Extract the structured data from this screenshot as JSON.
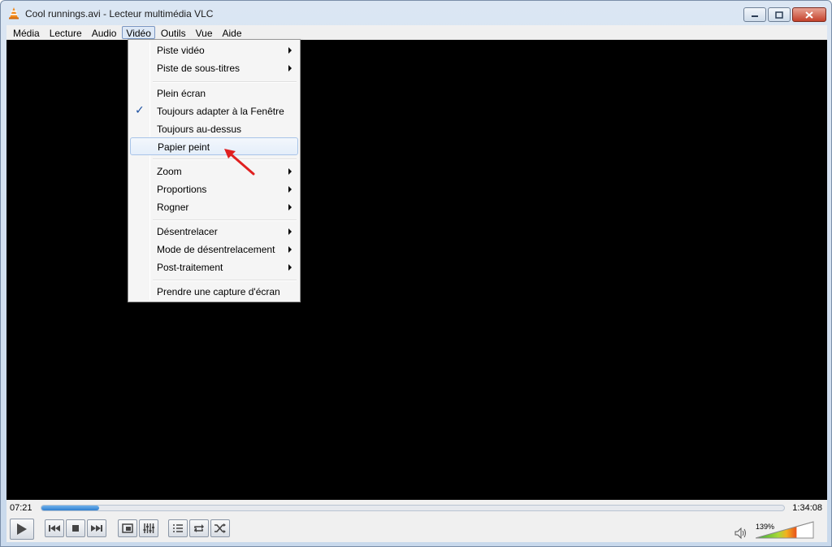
{
  "window": {
    "title": "Cool runnings.avi - Lecteur multimédia VLC"
  },
  "menubar": {
    "items": [
      "Média",
      "Lecture",
      "Audio",
      "Vidéo",
      "Outils",
      "Vue",
      "Aide"
    ],
    "active": "Vidéo"
  },
  "video_menu": {
    "items": [
      {
        "label": "Piste vidéo",
        "submenu": true
      },
      {
        "label": "Piste de sous-titres",
        "submenu": true
      },
      {
        "label": "Plein écran"
      },
      {
        "label": "Toujours adapter à la Fenêtre",
        "checked": true
      },
      {
        "label": "Toujours au-dessus"
      },
      {
        "label": "Papier peint",
        "highlighted": true
      },
      {
        "label": "Zoom",
        "submenu": true
      },
      {
        "label": "Proportions",
        "submenu": true
      },
      {
        "label": "Rogner",
        "submenu": true
      },
      {
        "label": "Désentrelacer",
        "submenu": true
      },
      {
        "label": "Mode de désentrelacement",
        "submenu": true
      },
      {
        "label": "Post-traitement",
        "submenu": true
      },
      {
        "label": "Prendre une capture d'écran"
      }
    ]
  },
  "player": {
    "elapsed": "07:21",
    "total": "1:34:08",
    "progress_fraction": 0.078,
    "volume_label": "139%",
    "volume_fraction": 0.7
  },
  "colors": {
    "accent": "#2f7fd0",
    "annotation": "#e02020",
    "video_bg": "#000000"
  },
  "icons": {
    "app": "vlc-cone-icon",
    "play": "play-icon",
    "prev": "previous-icon",
    "stop": "stop-icon",
    "next": "next-icon",
    "fullscreen": "fullscreen-icon",
    "equalizer": "equalizer-icon",
    "playlist": "playlist-icon",
    "loop": "loop-icon",
    "random": "shuffle-icon",
    "volume": "speaker-icon"
  }
}
